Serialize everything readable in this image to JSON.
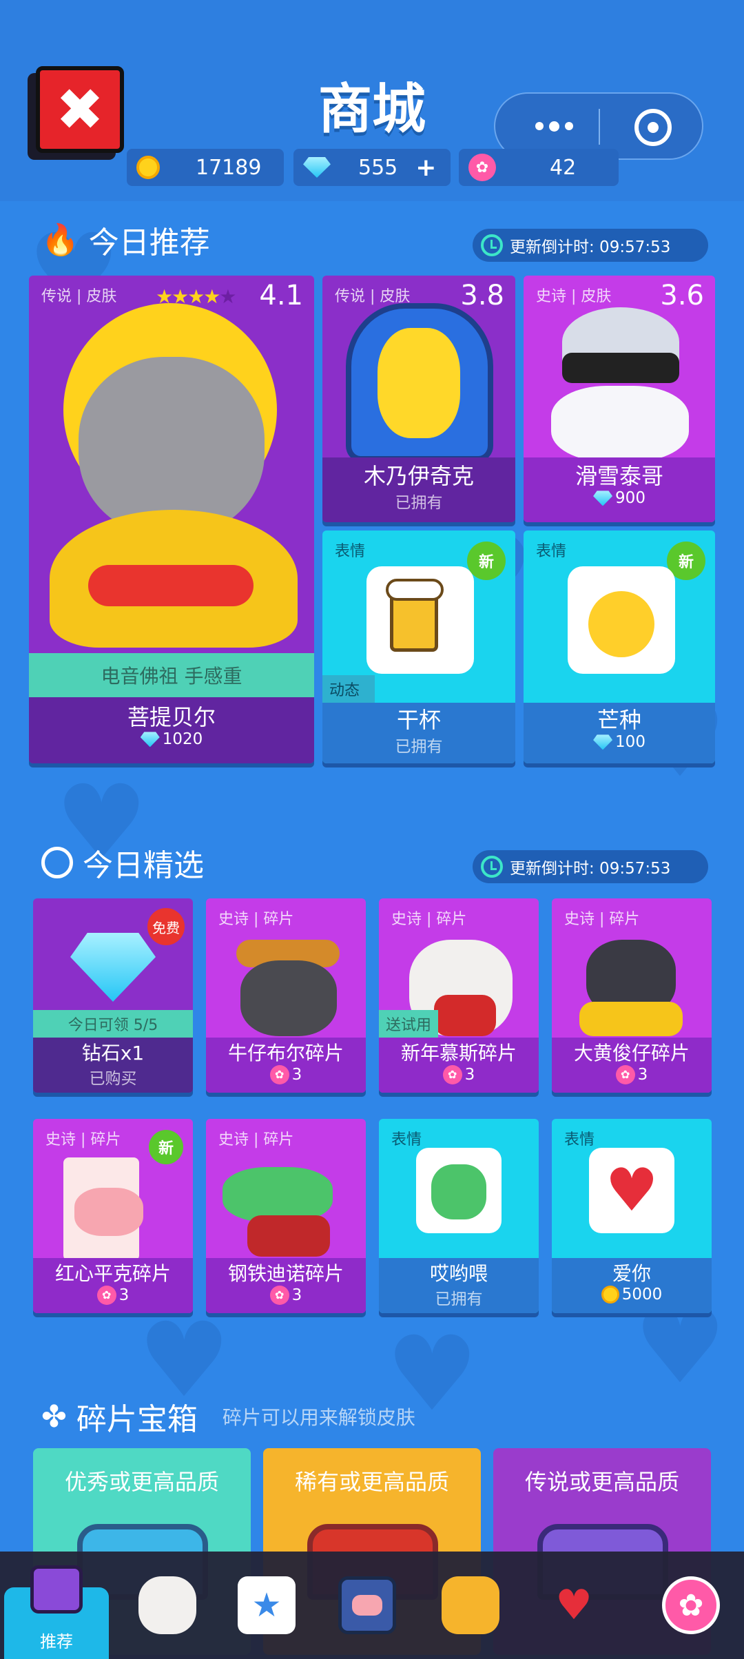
{
  "header": {
    "title": "商城"
  },
  "currencies": [
    {
      "icon": "coin-icon",
      "value": "17189"
    },
    {
      "icon": "gem-icon",
      "value": "555",
      "add": "+"
    },
    {
      "icon": "flower-icon",
      "value": "42"
    }
  ],
  "today_recommend": {
    "title": "今日推荐",
    "countdown": "更新倒计时: 09:57:53",
    "featured": {
      "meta": "传说 | 皮肤",
      "rating": "4.1",
      "stars": 4,
      "tagline": "电音佛祖 手感重",
      "name": "菩提贝尔",
      "price": "1020"
    },
    "cards": [
      {
        "meta": "传说 | 皮肤",
        "rating": "3.8",
        "name": "木乃伊奇克",
        "sub": "已拥有"
      },
      {
        "meta": "史诗 | 皮肤",
        "rating": "3.6",
        "name": "滑雪泰哥",
        "price": "900"
      },
      {
        "meta": "表情",
        "badge": "新",
        "tag": "动态",
        "name": "干杯",
        "sub": "已拥有"
      },
      {
        "meta": "表情",
        "badge": "新",
        "name": "芒种",
        "price": "100"
      }
    ]
  },
  "today_select": {
    "title": "今日精选",
    "countdown": "更新倒计时: 09:57:53",
    "items": [
      {
        "badge": "免费",
        "tag": "今日可领 5/5",
        "name": "钻石x1",
        "sub": "已购买"
      },
      {
        "meta": "史诗 | 碎片",
        "name": "牛仔布尔碎片",
        "price": "3"
      },
      {
        "meta": "史诗 | 碎片",
        "tag": "送试用",
        "name": "新年慕斯碎片",
        "price": "3"
      },
      {
        "meta": "史诗 | 碎片",
        "name": "大黄俊仔碎片",
        "price": "3"
      },
      {
        "meta": "史诗 | 碎片",
        "badge": "新",
        "name": "红心平克碎片",
        "price": "3"
      },
      {
        "meta": "史诗 | 碎片",
        "name": "钢铁迪诺碎片",
        "price": "3"
      },
      {
        "meta": "表情",
        "name": "哎哟喂",
        "sub": "已拥有"
      },
      {
        "meta": "表情",
        "name": "爱你",
        "price": "5000"
      }
    ]
  },
  "chests": {
    "title": "碎片宝箱",
    "hint": "碎片可以用来解锁皮肤",
    "items": [
      {
        "label": "优秀或更高品质"
      },
      {
        "label": "稀有或更高品质"
      },
      {
        "label": "传说或更高品质"
      }
    ]
  },
  "nav": {
    "active_label": "推荐"
  },
  "colors": {
    "background": "#2f86e8",
    "legend_purple": "#8b2fc9",
    "epic_pink": "#c43ce8",
    "emote_cyan": "#1ad4ee",
    "accent_green": "#5ac82c"
  }
}
